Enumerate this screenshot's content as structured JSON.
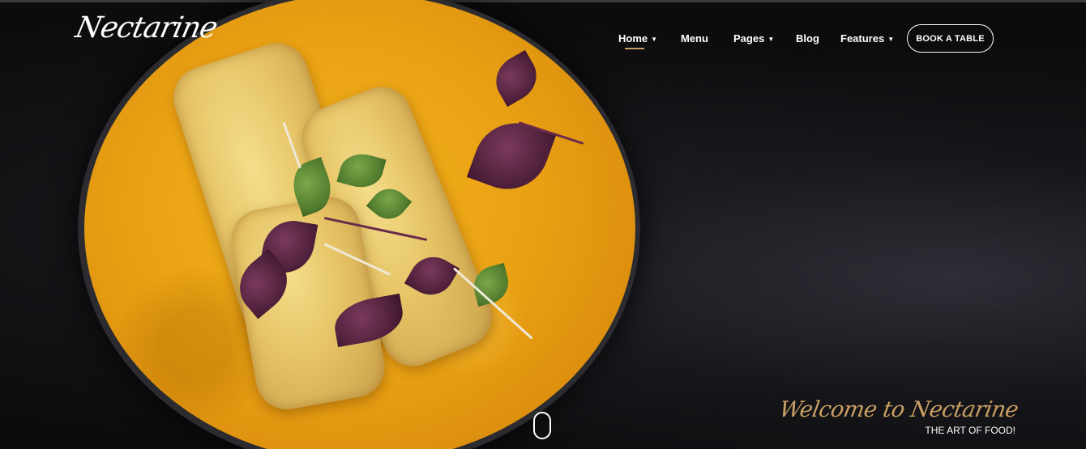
{
  "brand": {
    "logo_text": "Nectarine"
  },
  "nav": {
    "items": [
      {
        "label": "Home",
        "has_dropdown": true,
        "active": true
      },
      {
        "label": "Menu",
        "has_dropdown": false
      },
      {
        "label": "Pages",
        "has_dropdown": true
      },
      {
        "label": "Blog",
        "has_dropdown": false
      },
      {
        "label": "Features",
        "has_dropdown": true
      }
    ],
    "cta_label": "BOOK A TABLE",
    "caret_glyph": "▼"
  },
  "hero": {
    "welcome_text": "Welcome to Nectarine",
    "tagline": "THE ART OF FOOD!"
  },
  "colors": {
    "accent": "#c9a063",
    "sauce": "#eaa214",
    "background": "#111111"
  },
  "icons": {
    "scroll_indicator": "mouse-scroll-icon",
    "dropdown": "chevron-down-icon"
  }
}
